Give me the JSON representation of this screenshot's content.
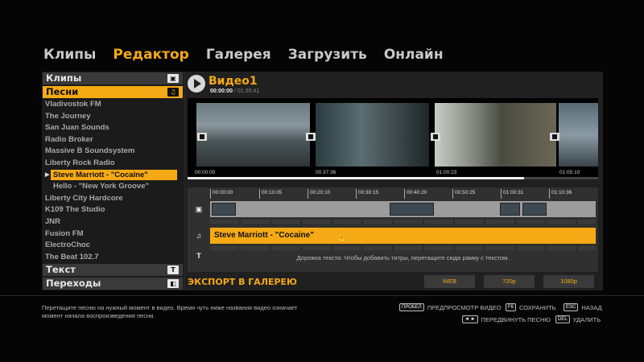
{
  "nav": {
    "tabs": [
      {
        "label": "Клипы",
        "active": false
      },
      {
        "label": "Редактор",
        "active": true
      },
      {
        "label": "Галерея",
        "active": false
      },
      {
        "label": "Загрузить",
        "active": false
      },
      {
        "label": "Онлайн",
        "active": false
      }
    ]
  },
  "sidebar": {
    "clips_header": "Клипы",
    "songs_header": "Песни",
    "songs": [
      "Vladivostok FM",
      "The Journey",
      "San Juan Sounds",
      "Radio Broker",
      "Massive B Soundsystem",
      "Liberty Rock Radio",
      "Steve Marriott - \"Cocaine\"",
      "Hello  - \"New York Groove\"",
      "Liberty City Hardcore",
      "K109 The Studio",
      "JNR",
      "Fusion FM",
      "ElectroChoc",
      "The Beat 102.7"
    ],
    "selected_song_index": 6,
    "text_header": "Текст",
    "transitions_header": "Переходы",
    "icons": {
      "clips": "film-icon",
      "songs": "music-note-icon",
      "text": "text-icon",
      "transitions": "transition-icon"
    }
  },
  "video": {
    "title": "Видео1",
    "current_time": "00:00:00",
    "total_time": "/ 01:20:41",
    "thumb_times": [
      "00:00:00",
      "00:37:36",
      "01:00:23",
      "01:05:10"
    ],
    "progress_fraction": 0.82
  },
  "timeline": {
    "ticks": [
      "00:00:00",
      "00:10:05",
      "00:20:10",
      "00:30:15",
      "00:40:20",
      "00:50:25",
      "01:00:31",
      "01:10:36"
    ],
    "audio_clip_label": "Steve Marriott - \"Cocaine\"",
    "text_track_hint": "Дорожка текста: Чтобы добавить титры, перетащите сюда рамку с текстом."
  },
  "export": {
    "label": "ЭКСПОРТ В ГАЛЕРЕЮ",
    "buttons": [
      "WEB",
      "720p",
      "1080p"
    ]
  },
  "footer": {
    "help": "Перетащите песню на нужный момент в видео. Время чуть ниже названия видео означает момент начала воспроизведения песни.",
    "hints": [
      {
        "key": "ПРОБЕЛ",
        "label": "ПРЕДПРОСМОТР ВИДЕО"
      },
      {
        "key": "F6",
        "label": "СОХРАНИТЬ"
      },
      {
        "key": "ESC",
        "label": "НАЗАД"
      },
      {
        "key": "◄ ►",
        "label": "ПЕРЕДВИНУТЬ ПЕСНЮ"
      },
      {
        "key": "DEL",
        "label": "УДАЛИТЬ"
      }
    ]
  },
  "colors": {
    "accent": "#f5a915",
    "panel": "#242424",
    "background": "#050505"
  }
}
